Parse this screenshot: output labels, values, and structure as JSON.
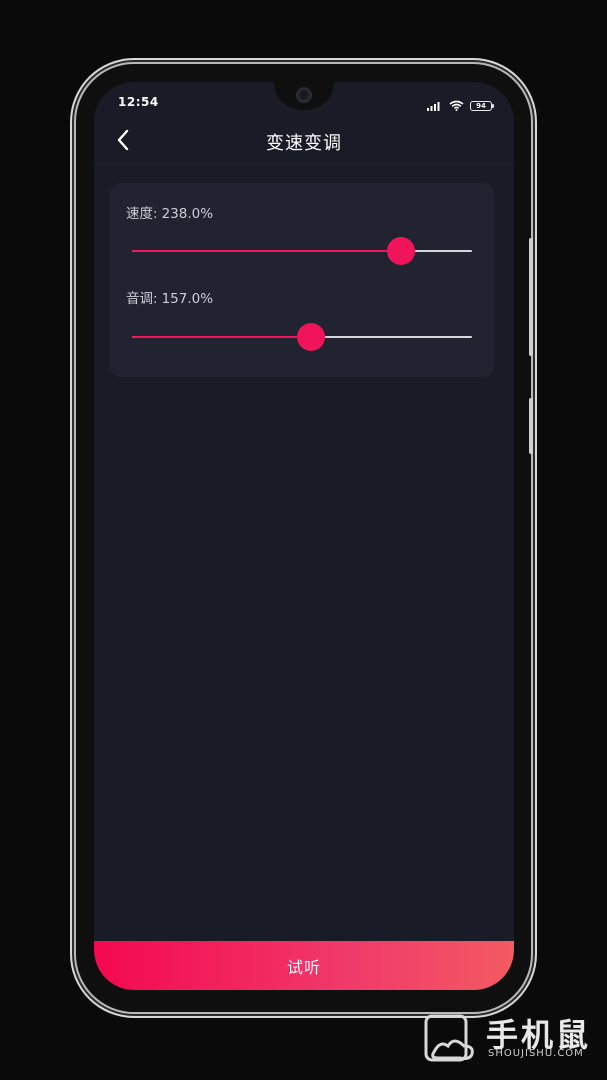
{
  "status_bar": {
    "time": "12:54",
    "battery_level": "94",
    "icons": [
      "signal-icon",
      "wifi-icon",
      "battery-icon"
    ]
  },
  "header": {
    "title": "变速变调",
    "back_icon": "chevron-left-icon"
  },
  "settings": {
    "speed": {
      "label": "速度",
      "separator": ":",
      "value_text": "238.0%",
      "slider_fraction": 0.79
    },
    "pitch": {
      "label": "音调",
      "separator": ":",
      "value_text": "157.0%",
      "slider_fraction": 0.525
    }
  },
  "bottom_button": {
    "label": "试听"
  },
  "watermark": {
    "title": "手机鼠",
    "subtitle": "SHOUJISHU.COM"
  },
  "colors": {
    "accent": "#f0145a",
    "background": "#191b26",
    "card": "#212330"
  }
}
